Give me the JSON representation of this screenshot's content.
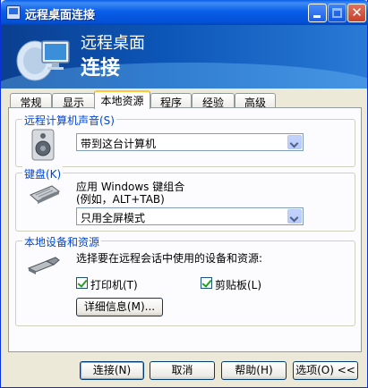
{
  "window": {
    "title": "远程桌面连接"
  },
  "banner": {
    "line1": "远程桌面",
    "line2": "连接"
  },
  "tabs": [
    {
      "label": "常规"
    },
    {
      "label": "显示"
    },
    {
      "label": "本地资源",
      "active": true
    },
    {
      "label": "程序"
    },
    {
      "label": "经验"
    },
    {
      "label": "高级"
    }
  ],
  "sound": {
    "group_label": "远程计算机声音(S)",
    "selected": "带到这台计算机"
  },
  "keyboard": {
    "group_label": "键盘(K)",
    "line1": "应用 Windows 键组合",
    "line2": "(例如，ALT+TAB)",
    "selected": "只用全屏模式"
  },
  "devices": {
    "group_label": "本地设备和资源",
    "description": "选择要在远程会话中使用的设备和资源:",
    "printers_label": "打印机(T)",
    "printers_checked": true,
    "clipboard_label": "剪贴板(L)",
    "clipboard_checked": true,
    "details_button": "详细信息(M)..."
  },
  "footer": {
    "connect": "连接(N)",
    "cancel": "取消",
    "help": "帮助(H)",
    "options": "选项(O) <<"
  },
  "colors": {
    "title_blue": "#0a5ee8",
    "group_label": "#0046d5",
    "tab_highlight": "#ffc73c",
    "dialog_bg": "#ece9d8"
  }
}
